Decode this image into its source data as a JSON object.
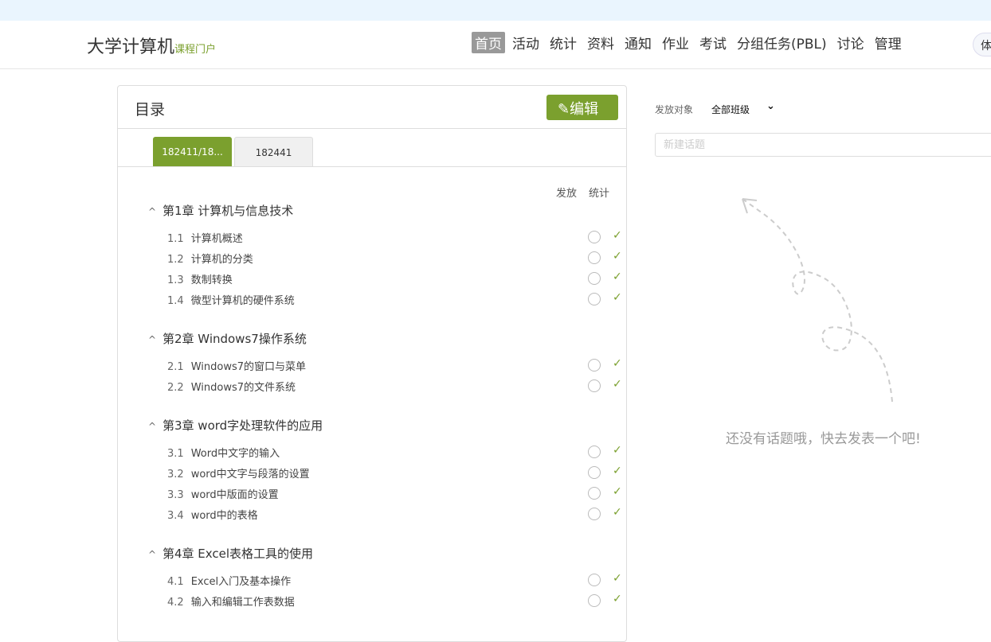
{
  "header": {
    "logo": "大学计算机",
    "logo_sub": "课程门户",
    "nav": [
      "首页",
      "活动",
      "统计",
      "资料",
      "通知",
      "作业",
      "考试",
      "分组任务(PBL)",
      "讨论",
      "管理"
    ],
    "active": "首页",
    "right_button": "体"
  },
  "catalog": {
    "title": "目录",
    "edit_label": "编辑",
    "tabs": [
      "182411/18...",
      "182441"
    ],
    "col_publish": "发放",
    "col_stats": "统计",
    "chapters": [
      {
        "title": "第1章 计算机与信息技术",
        "sections": [
          [
            "1.1",
            "计算机概述"
          ],
          [
            "1.2",
            "计算机的分类"
          ],
          [
            "1.3",
            "数制转换"
          ],
          [
            "1.4",
            "微型计算机的硬件系统"
          ]
        ]
      },
      {
        "title": "第2章 Windows7操作系统",
        "sections": [
          [
            "2.1",
            "Windows7的窗口与菜单"
          ],
          [
            "2.2",
            "Windows7的文件系统"
          ]
        ]
      },
      {
        "title": "第3章 word字处理软件的应用",
        "sections": [
          [
            "3.1",
            "Word中文字的输入"
          ],
          [
            "3.2",
            "word中文字与段落的设置"
          ],
          [
            "3.3",
            "word中版面的设置"
          ],
          [
            "3.4",
            "word中的表格"
          ]
        ]
      },
      {
        "title": "第4章 Excel表格工具的使用",
        "sections": [
          [
            "4.1",
            "Excel入门及基本操作"
          ],
          [
            "4.2",
            "输入和编辑工作表数据"
          ]
        ]
      }
    ]
  },
  "discussion": {
    "target_label": "发放对象",
    "target_value": "全部班级",
    "input_placeholder": "新建话题",
    "empty_text": "还没有话题哦，快去发表一个吧!"
  },
  "colors": {
    "accent": "#7ba02e"
  }
}
